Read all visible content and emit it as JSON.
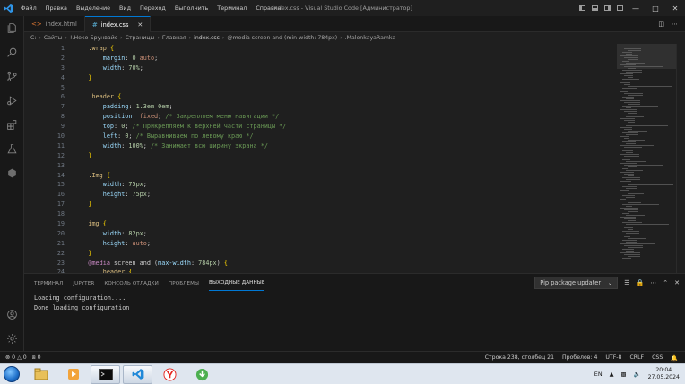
{
  "titlebar": {
    "menu": [
      "Файл",
      "Правка",
      "Выделение",
      "Вид",
      "Переход",
      "Выполнить",
      "Терминал",
      "Справка"
    ],
    "window_title": "index.css - Visual Studio Code [Администратор]"
  },
  "tabs": [
    {
      "name": "index.html",
      "active": false
    },
    {
      "name": "index.css",
      "active": true
    }
  ],
  "breadcrumb": [
    "C:",
    "Сайты",
    "!.Неко Брунвайс",
    "Страницы",
    "Главная",
    "index.css",
    "@media screen and (min-width: 784px)",
    ".MalenkayaRamka"
  ],
  "code": {
    "line_numbers": [
      "1",
      "2",
      "3",
      "4",
      "5",
      "6",
      "7",
      "8",
      "9",
      "10",
      "11",
      "12",
      "13",
      "14",
      "15",
      "16",
      "17",
      "18",
      "19",
      "20",
      "21",
      "22",
      "23",
      "24"
    ],
    "lines": [
      [
        {
          "t": "    ",
          "c": "t-punc"
        },
        {
          "t": ".wrap",
          "c": "t-sel"
        },
        {
          "t": " ",
          "c": "t-punc"
        },
        {
          "t": "{",
          "c": "t-brace"
        }
      ],
      [
        {
          "t": "        ",
          "c": "t-punc"
        },
        {
          "t": "margin",
          "c": "t-prop"
        },
        {
          "t": ": ",
          "c": "t-punc"
        },
        {
          "t": "0",
          "c": "t-num"
        },
        {
          "t": " auto",
          "c": "t-val"
        },
        {
          "t": ";",
          "c": "t-punc"
        }
      ],
      [
        {
          "t": "        ",
          "c": "t-punc"
        },
        {
          "t": "width",
          "c": "t-prop"
        },
        {
          "t": ": ",
          "c": "t-punc"
        },
        {
          "t": "70%",
          "c": "t-num"
        },
        {
          "t": ";",
          "c": "t-punc"
        }
      ],
      [
        {
          "t": "    ",
          "c": "t-punc"
        },
        {
          "t": "}",
          "c": "t-brace"
        }
      ],
      [
        {
          "t": "",
          "c": "t-punc"
        }
      ],
      [
        {
          "t": "    ",
          "c": "t-punc"
        },
        {
          "t": ".header",
          "c": "t-sel"
        },
        {
          "t": " ",
          "c": "t-punc"
        },
        {
          "t": "{",
          "c": "t-brace"
        }
      ],
      [
        {
          "t": "        ",
          "c": "t-punc"
        },
        {
          "t": "padding",
          "c": "t-prop"
        },
        {
          "t": ": ",
          "c": "t-punc"
        },
        {
          "t": "1.3em",
          "c": "t-num"
        },
        {
          "t": " ",
          "c": "t-punc"
        },
        {
          "t": "0em",
          "c": "t-num"
        },
        {
          "t": ";",
          "c": "t-punc"
        }
      ],
      [
        {
          "t": "        ",
          "c": "t-punc"
        },
        {
          "t": "position",
          "c": "t-prop"
        },
        {
          "t": ": ",
          "c": "t-punc"
        },
        {
          "t": "fixed",
          "c": "t-val"
        },
        {
          "t": "; ",
          "c": "t-punc"
        },
        {
          "t": "/* Закрепляем меню навигации */",
          "c": "t-com"
        }
      ],
      [
        {
          "t": "        ",
          "c": "t-punc"
        },
        {
          "t": "top",
          "c": "t-prop"
        },
        {
          "t": ": ",
          "c": "t-punc"
        },
        {
          "t": "0",
          "c": "t-num"
        },
        {
          "t": "; ",
          "c": "t-punc"
        },
        {
          "t": "/* Прикрепляем к верхней части страницы */",
          "c": "t-com"
        }
      ],
      [
        {
          "t": "        ",
          "c": "t-punc"
        },
        {
          "t": "left",
          "c": "t-prop"
        },
        {
          "t": ": ",
          "c": "t-punc"
        },
        {
          "t": "0",
          "c": "t-num"
        },
        {
          "t": "; ",
          "c": "t-punc"
        },
        {
          "t": "/* Выравниваем по левому краю */",
          "c": "t-com"
        }
      ],
      [
        {
          "t": "        ",
          "c": "t-punc"
        },
        {
          "t": "width",
          "c": "t-prop"
        },
        {
          "t": ": ",
          "c": "t-punc"
        },
        {
          "t": "100%",
          "c": "t-num"
        },
        {
          "t": "; ",
          "c": "t-punc"
        },
        {
          "t": "/* Занимает всю ширину экрана */",
          "c": "t-com"
        }
      ],
      [
        {
          "t": "    ",
          "c": "t-punc"
        },
        {
          "t": "}",
          "c": "t-brace"
        }
      ],
      [
        {
          "t": "",
          "c": "t-punc"
        }
      ],
      [
        {
          "t": "    ",
          "c": "t-punc"
        },
        {
          "t": ".Img",
          "c": "t-sel"
        },
        {
          "t": " ",
          "c": "t-punc"
        },
        {
          "t": "{",
          "c": "t-brace"
        }
      ],
      [
        {
          "t": "        ",
          "c": "t-punc"
        },
        {
          "t": "width",
          "c": "t-prop"
        },
        {
          "t": ": ",
          "c": "t-punc"
        },
        {
          "t": "75px",
          "c": "t-num"
        },
        {
          "t": ";",
          "c": "t-punc"
        }
      ],
      [
        {
          "t": "        ",
          "c": "t-punc"
        },
        {
          "t": "height",
          "c": "t-prop"
        },
        {
          "t": ": ",
          "c": "t-punc"
        },
        {
          "t": "75px",
          "c": "t-num"
        },
        {
          "t": ";",
          "c": "t-punc"
        }
      ],
      [
        {
          "t": "    ",
          "c": "t-punc"
        },
        {
          "t": "}",
          "c": "t-brace"
        }
      ],
      [
        {
          "t": "",
          "c": "t-punc"
        }
      ],
      [
        {
          "t": "    ",
          "c": "t-punc"
        },
        {
          "t": "img",
          "c": "t-kw"
        },
        {
          "t": " ",
          "c": "t-punc"
        },
        {
          "t": "{",
          "c": "t-brace"
        }
      ],
      [
        {
          "t": "        ",
          "c": "t-punc"
        },
        {
          "t": "width",
          "c": "t-prop"
        },
        {
          "t": ": ",
          "c": "t-punc"
        },
        {
          "t": "82px",
          "c": "t-num"
        },
        {
          "t": ";",
          "c": "t-punc"
        }
      ],
      [
        {
          "t": "        ",
          "c": "t-punc"
        },
        {
          "t": "height",
          "c": "t-prop"
        },
        {
          "t": ": ",
          "c": "t-punc"
        },
        {
          "t": "auto",
          "c": "t-val"
        },
        {
          "t": ";",
          "c": "t-punc"
        }
      ],
      [
        {
          "t": "    ",
          "c": "t-punc"
        },
        {
          "t": "}",
          "c": "t-brace"
        }
      ],
      [
        {
          "t": "    ",
          "c": "t-punc"
        },
        {
          "t": "@media",
          "c": "t-at"
        },
        {
          "t": " screen and (",
          "c": "t-punc"
        },
        {
          "t": "max-width",
          "c": "t-prop"
        },
        {
          "t": ": ",
          "c": "t-punc"
        },
        {
          "t": "784px",
          "c": "t-num"
        },
        {
          "t": ") ",
          "c": "t-punc"
        },
        {
          "t": "{",
          "c": "t-brace"
        }
      ],
      [
        {
          "t": "        ",
          "c": "t-punc"
        },
        {
          "t": "header",
          "c": "t-kw"
        },
        {
          "t": " ",
          "c": "t-punc"
        },
        {
          "t": "{",
          "c": "t-brace"
        }
      ]
    ]
  },
  "panel": {
    "tabs": [
      {
        "label": "ТЕРМИНАЛ",
        "active": false
      },
      {
        "label": "JUPYTER",
        "active": false
      },
      {
        "label": "КОНСОЛЬ ОТЛАДКИ",
        "active": false
      },
      {
        "label": "ПРОБЛЕМЫ",
        "active": false
      },
      {
        "label": "ВЫХОДНЫЕ ДАННЫЕ",
        "active": true
      }
    ],
    "output_channel": "Pip package updater",
    "output_lines": [
      "Loading configuration....",
      "Done loading configuration"
    ]
  },
  "statusbar": {
    "errors": "0",
    "warnings": "0",
    "ports": "0",
    "position": "Строка 238, столбец 21",
    "spaces": "Пробелов: 4",
    "encoding": "UTF-8",
    "eol": "CRLF",
    "language": "CSS"
  },
  "taskbar": {
    "language": "EN",
    "time": "20:04",
    "date": "27.05.2024"
  },
  "colors": {
    "accent": "#0078d4",
    "editor_bg": "#1f1f1f"
  }
}
